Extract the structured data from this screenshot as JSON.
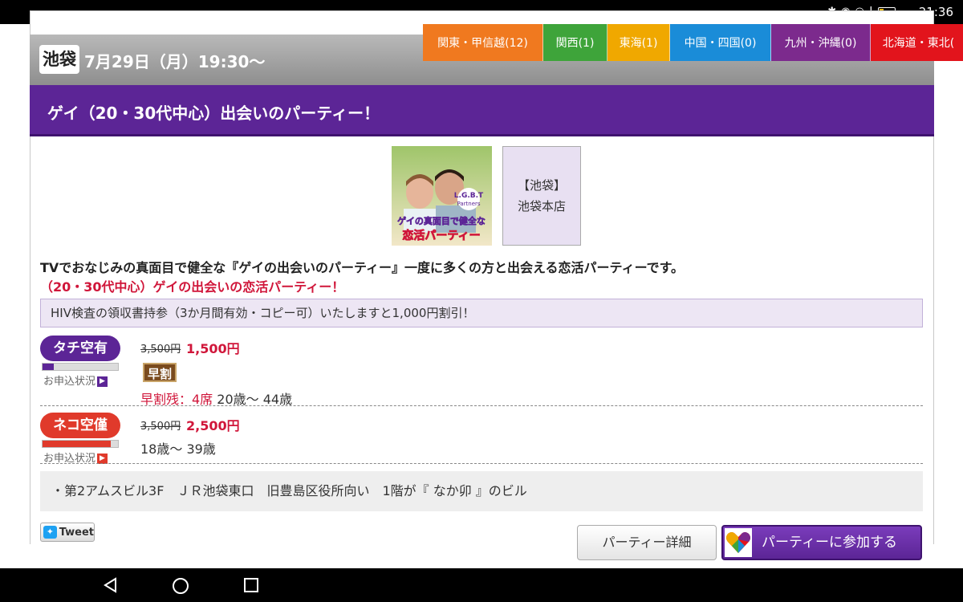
{
  "status_bar": {
    "time": "21:36"
  },
  "region_tabs": [
    {
      "label": "関東・甲信越(12)",
      "color": "#f0791f",
      "text_color": "#fff",
      "width": 150
    },
    {
      "label": "関西(1)",
      "color": "#3ea43a",
      "width": 80
    },
    {
      "label": "東海(1)",
      "color": "#f0a800",
      "width": 78
    },
    {
      "label": "中国・四国(0)",
      "color": "#1a8cd8",
      "width": 126
    },
    {
      "label": "九州・沖縄(0)",
      "color": "#7c2a8d",
      "width": 124
    },
    {
      "label": "北海道・東北(",
      "color": "#e2141c",
      "width": 120
    }
  ],
  "event": {
    "area": "池袋",
    "date": "7月29日（月）19:30〜",
    "title": "ゲイ（20・30代中心）出会いのパーティー！",
    "photo_text": {
      "logo_line1": "L.G.B.T",
      "logo_line2": "Partners",
      "catch1": "ゲイの真面目で健全な",
      "catch2": "恋活パーティー"
    },
    "location_line1": "【池袋】",
    "location_line2": "池袋本店",
    "description": "TVでおなじみの真面目で健全な『ゲイの出会いのパーティー』一度に多くの方と出会える恋活パーティーです。",
    "description_sub": "（20・30代中心）ゲイの出会いの恋活パーティー！",
    "notice": "HIV検査の領収書持参（3か月間有効・コピー可）いたしますと1,000円割引！"
  },
  "tickets": [
    {
      "badge": "タチ空有",
      "status_label": "お申込状況",
      "fill_fraction": 0.15,
      "price_old": "3,500円",
      "price_new": "1,500円",
      "early_badge": "早割",
      "seats_label": "早割残：4席",
      "age_range": "20歳〜 44歳"
    },
    {
      "badge": "ネコ空僅",
      "status_label": "お申込状況",
      "fill_fraction": 0.9,
      "price_old": "3,500円",
      "price_new": "2,500円",
      "age_range": "18歳〜 39歳"
    }
  ],
  "access": "・第2アムスビル3F　ＪＲ池袋東口　旧豊島区役所向い　1階が『 なか卯 』のビル",
  "buttons": {
    "tweet": "Tweet",
    "detail": "パーティー詳細",
    "join": "パーティーに参加する"
  },
  "colors": {
    "purple": "#5c2596",
    "red": "#d0163a",
    "tachi_badge": "#5c2596",
    "neko_badge": "#e03a2b"
  }
}
